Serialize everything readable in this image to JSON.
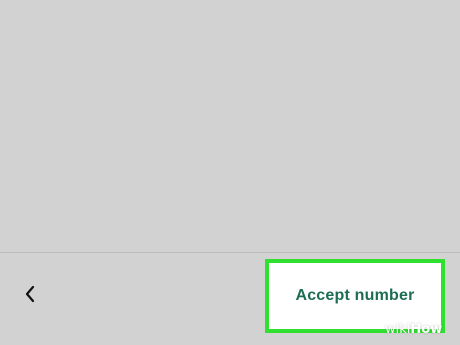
{
  "colors": {
    "background": "#d2d2d2",
    "divider": "#bcbcbc",
    "accept_text": "#1d6d55",
    "highlight_border": "#2fe02f",
    "button_background": "#ffffff"
  },
  "navigation": {
    "back_icon": "chevron-left-icon"
  },
  "actions": {
    "accept_label": "Accept number"
  },
  "watermark": {
    "brand_light": "wiki",
    "brand_bold": "How"
  }
}
